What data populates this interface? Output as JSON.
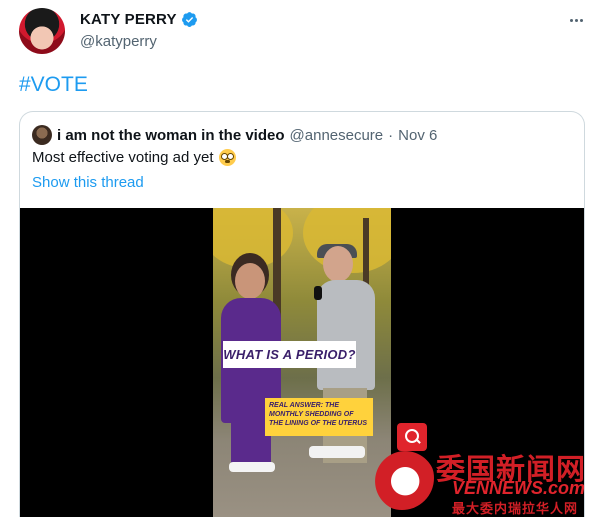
{
  "tweet": {
    "author": {
      "display_name": "KATY PERRY",
      "handle": "@katyperry",
      "verified": true
    },
    "text": "#VOTE"
  },
  "quoted_tweet": {
    "author": {
      "display_name": "i am not the woman in the video",
      "handle": "@annesecure"
    },
    "separator": "·",
    "date": "Nov 6",
    "text": "Most effective voting ad yet",
    "emoji": "flushed-face-emoji",
    "show_thread_label": "Show this thread",
    "video": {
      "caption_question": "WHAT IS A PERIOD?",
      "caption_answer": "REAL ANSWER: THE MONTHLY SHEDDING OF THE LINING OF THE UTERUS"
    }
  },
  "watermark": {
    "title": "委国新闻网",
    "domain": "VENNEWS.com",
    "slogan": "最大委内瑞拉华人网"
  },
  "colors": {
    "link": "#1d9bf0",
    "muted": "#536471",
    "accent": "#d21f26"
  }
}
